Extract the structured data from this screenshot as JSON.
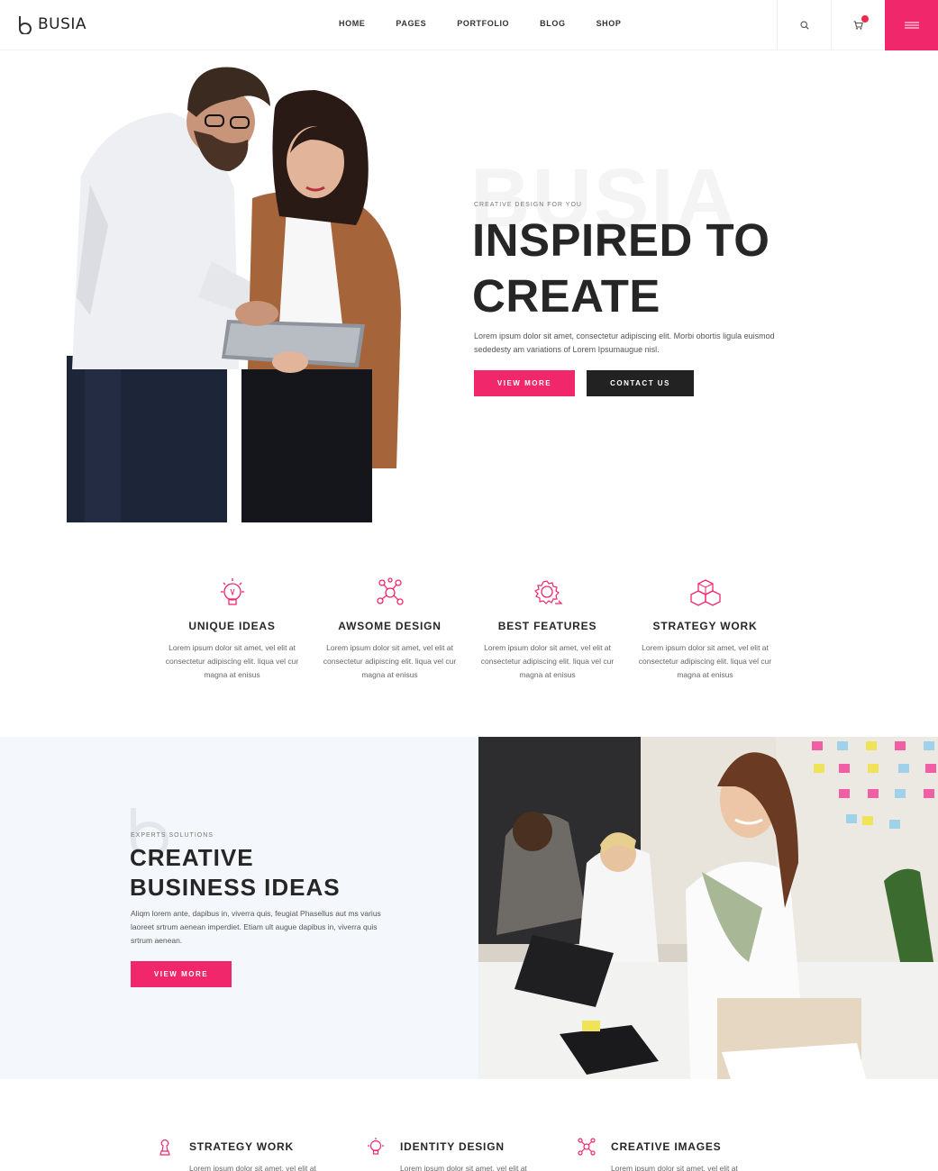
{
  "brand": {
    "name": "BUSIA"
  },
  "nav": {
    "items": [
      "HOME",
      "PAGES",
      "PORTFOLIO",
      "BLOG",
      "SHOP"
    ]
  },
  "header_icons": {
    "search": "search-icon",
    "cart": "cart-icon",
    "menu": "hamburger-menu-icon"
  },
  "colors": {
    "accent": "#f0276b",
    "dark": "#222222",
    "section_bg": "#f4f7fb",
    "text": "#262626"
  },
  "hero": {
    "watermark": "BUSIA",
    "subtitle": "CREATIVE DESIGN FOR YOU",
    "title_line1": "INSPIRED TO",
    "title_line2": "CREATE",
    "description": "Lorem ipsum dolor sit amet, consectetur adipiscing elit. Morbi obortis ligula euismod sededesty am variations of Lorem Ipsumaugue nisl.",
    "primary_button": "VIEW MORE",
    "secondary_button": "CONTACT US"
  },
  "features": [
    {
      "icon": "lightbulb-icon",
      "title": "UNIQUE IDEAS",
      "text": "Lorem ipsum dolor sit amet, vel elit at consectetur adipiscing elit. liqua vel cur magna at enisus"
    },
    {
      "icon": "network-design-icon",
      "title": "AWSOME DESIGN",
      "text": "Lorem ipsum dolor sit amet, vel elit at consectetur adipiscing elit. liqua vel cur magna at enisus"
    },
    {
      "icon": "gear-cycle-icon",
      "title": "BEST FEATURES",
      "text": "Lorem ipsum dolor sit amet, vel elit at consectetur adipiscing elit. liqua vel cur magna at enisus"
    },
    {
      "icon": "cubes-icon",
      "title": "STRATEGY WORK",
      "text": "Lorem ipsum dolor sit amet, vel elit at consectetur adipiscing elit. liqua vel cur magna at enisus"
    }
  ],
  "creative": {
    "subtitle": "EXPERTS SOLUTIONS",
    "title_line1": "CREATIVE",
    "title_line2": "BUSINESS IDEAS",
    "description": "Aliqm lorem ante, dapibus in, viverra quis, feugiat Phasellus aut ms varius laoreet srtrum aenean imperdiet. Etiam ult augue dapibus in, viverra quis srtrum aenean.",
    "button": "VIEW MORE"
  },
  "services": [
    {
      "icon": "chess-piece-icon",
      "title": "STRATEGY WORK",
      "text": "Lorem ipsum dolor sit amet, vel elit at"
    },
    {
      "icon": "lightbulb-icon",
      "title": "IDENTITY DESIGN",
      "text": "Lorem ipsum dolor sit amet, vel elit at"
    },
    {
      "icon": "network-design-icon",
      "title": "CREATIVE IMAGES",
      "text": "Lorem ipsum dolor sit amet, vel elit at"
    }
  ]
}
